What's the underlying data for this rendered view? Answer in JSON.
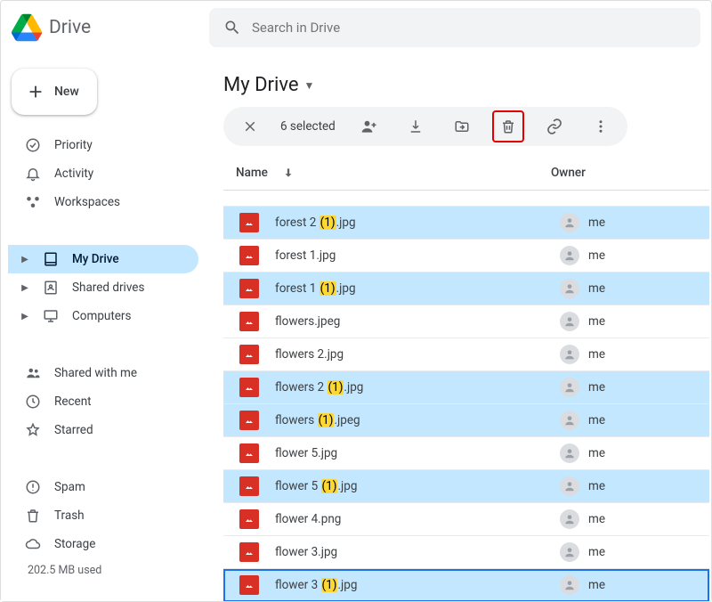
{
  "app_name": "Drive",
  "search": {
    "placeholder": "Search in Drive"
  },
  "new_button": "New",
  "nav": {
    "priority": "Priority",
    "activity": "Activity",
    "workspaces": "Workspaces",
    "my_drive": "My Drive",
    "shared_drives": "Shared drives",
    "computers": "Computers",
    "shared_with_me": "Shared with me",
    "recent": "Recent",
    "starred": "Starred",
    "spam": "Spam",
    "trash": "Trash",
    "storage": "Storage",
    "storage_used": "202.5 MB used"
  },
  "main": {
    "breadcrumb": "My Drive",
    "selected_count": "6 selected",
    "columns": {
      "name": "Name",
      "owner": "Owner"
    }
  },
  "files": [
    {
      "name_pre": "forest 2 ",
      "dup": "(1)",
      "name_post": ".jpg",
      "owner": "me",
      "selected": true,
      "focused": false
    },
    {
      "name_pre": "forest 1.jpg",
      "dup": "",
      "name_post": "",
      "owner": "me",
      "selected": false,
      "focused": false
    },
    {
      "name_pre": "forest 1 ",
      "dup": "(1)",
      "name_post": ".jpg",
      "owner": "me",
      "selected": true,
      "focused": false
    },
    {
      "name_pre": "flowers.jpeg",
      "dup": "",
      "name_post": "",
      "owner": "me",
      "selected": false,
      "focused": false
    },
    {
      "name_pre": "flowers 2.jpg",
      "dup": "",
      "name_post": "",
      "owner": "me",
      "selected": false,
      "focused": false
    },
    {
      "name_pre": "flowers 2 ",
      "dup": "(1)",
      "name_post": ".jpg",
      "owner": "me",
      "selected": true,
      "focused": false
    },
    {
      "name_pre": "flowers ",
      "dup": "(1)",
      "name_post": ".jpeg",
      "owner": "me",
      "selected": true,
      "focused": false
    },
    {
      "name_pre": "flower 5.jpg",
      "dup": "",
      "name_post": "",
      "owner": "me",
      "selected": false,
      "focused": false
    },
    {
      "name_pre": "flower 5 ",
      "dup": "(1)",
      "name_post": ".jpg",
      "owner": "me",
      "selected": true,
      "focused": false
    },
    {
      "name_pre": "flower 4.png",
      "dup": "",
      "name_post": "",
      "owner": "me",
      "selected": false,
      "focused": false
    },
    {
      "name_pre": "flower 3.jpg",
      "dup": "",
      "name_post": "",
      "owner": "me",
      "selected": false,
      "focused": false
    },
    {
      "name_pre": "flower 3 ",
      "dup": "(1)",
      "name_post": ".jpg",
      "owner": "me",
      "selected": true,
      "focused": true
    }
  ]
}
